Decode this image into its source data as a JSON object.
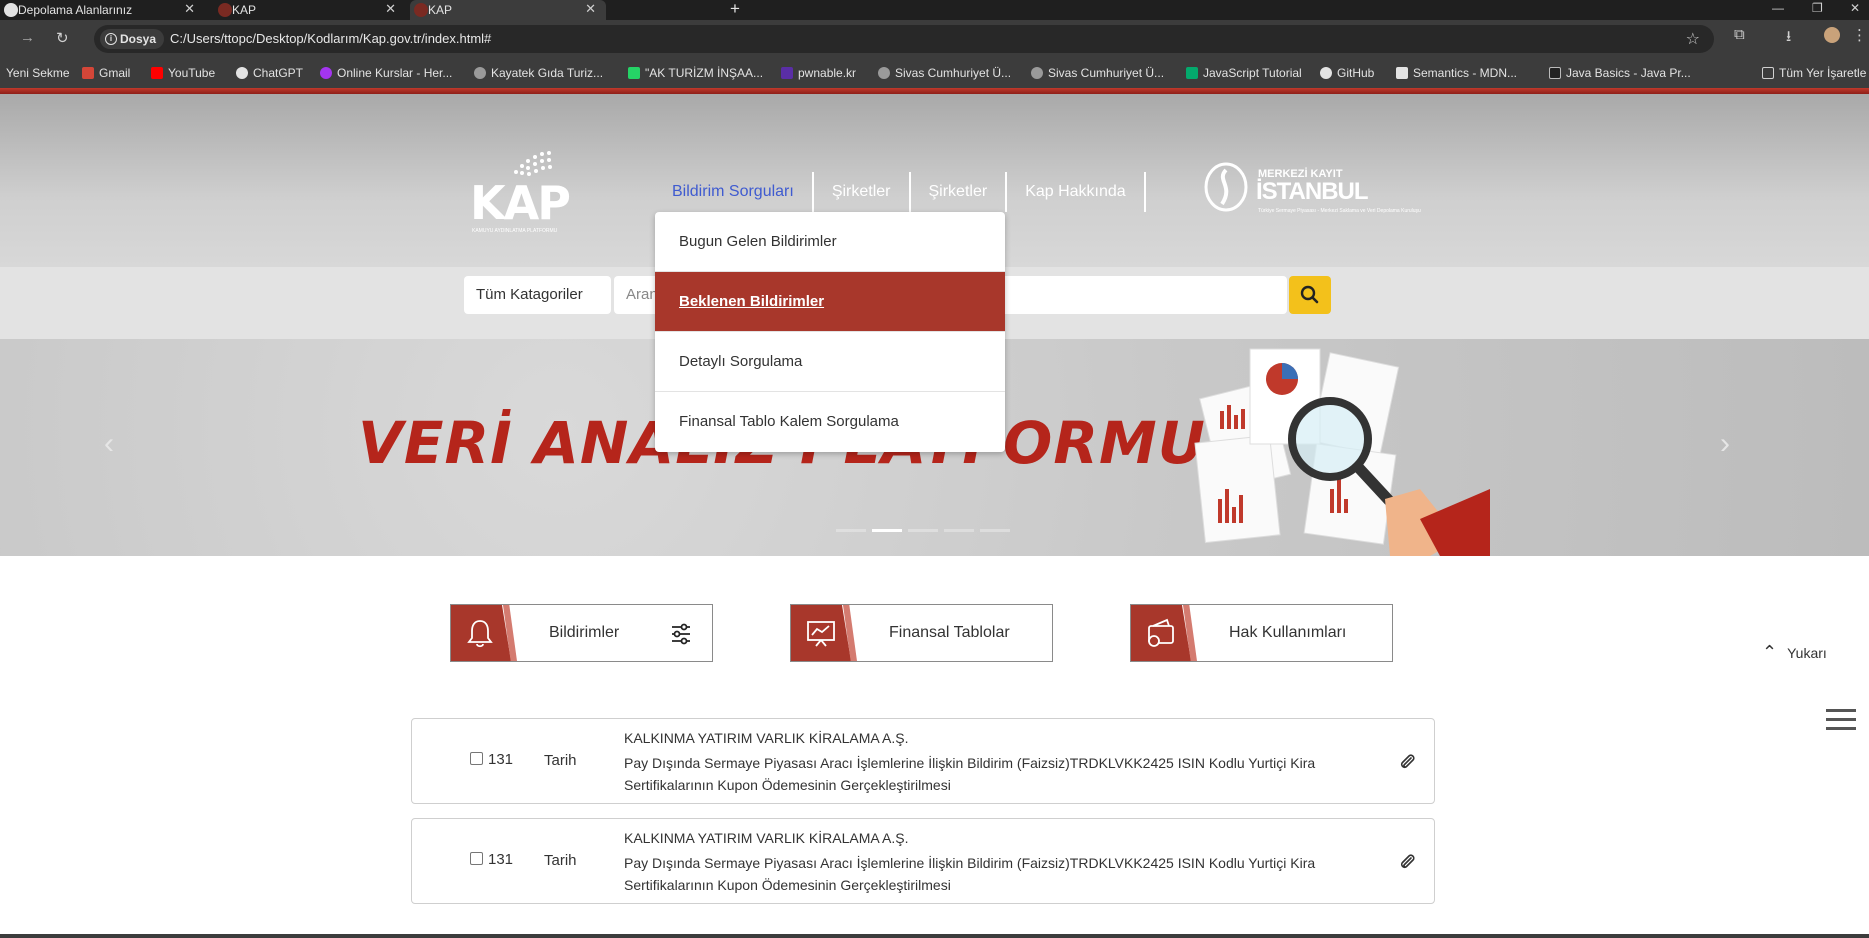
{
  "browser": {
    "tabs": [
      {
        "label": "Depolama Alanlarınız"
      },
      {
        "label": "KAP"
      },
      {
        "label": "KAP"
      }
    ],
    "new_tab": "+",
    "security_label": "Dosya",
    "url": "C:/Users/ttopc/Desktop/Kodlarım/Kap.gov.tr/index.html#",
    "bookmarks": [
      "Yeni Sekme",
      "Gmail",
      "YouTube",
      "ChatGPT",
      "Online Kurslar - Her...",
      "Kayatek Gıda Turiz...",
      "\"AK TURİZM İNŞAA...",
      "pwnable.kr",
      "Sivas Cumhuriyet Ü...",
      "Sivas Cumhuriyet Ü...",
      "JavaScript Tutorial",
      "GitHub",
      "Semantics - MDN...",
      "Java Basics - Java Pr...",
      "Tüm Yer İşaretle"
    ]
  },
  "header": {
    "logo_text": "KAP",
    "logo_sub": "KAMUYU AYDINLATMA PLATFORMU",
    "nav": [
      "Bildirim Sorguları",
      "Şirketler",
      "Şirketler",
      "Kap Hakkında"
    ],
    "partner_logo": {
      "line1": "MERKEZİ KAYIT",
      "line2": "İSTANBUL",
      "line3": "Türkiye Sermaye Piyasası - Merkezi Saklama ve Veri Depolama Kuruluşu"
    }
  },
  "dropdown": {
    "items": [
      "Bugun Gelen Bildirimler",
      "Beklenen Bildirimler",
      "Detaylı Sorgulama",
      "Finansal Tablo Kalem Sorgulama"
    ],
    "active_index": 1
  },
  "search": {
    "category": "Tüm Katagoriler",
    "placeholder": "Aranacak"
  },
  "banner": {
    "title": "VERİ ANALİZ PLATFORMU",
    "active_slide": 2,
    "slide_count": 5
  },
  "quick_links": [
    {
      "label": "Bildirimler",
      "icon": "bell-icon"
    },
    {
      "label": "Finansal Tablolar",
      "icon": "chart-board-icon"
    },
    {
      "label": "Hak Kullanımları",
      "icon": "wallet-icon"
    }
  ],
  "scroll_top": "Yukarı",
  "notifications": [
    {
      "number": "131",
      "date_label": "Tarih",
      "company": "KALKINMA YATIRIM VARLIK KİRALAMA A.Ş.",
      "description": "Pay Dışında Sermaye Piyasası Aracı İşlemlerine İlişkin Bildirim (Faizsiz)TRDKLVKK2425 ISIN Kodlu Yurtiçi Kira Sertifikalarının Kupon Ödemesinin Gerçekleştirilmesi"
    },
    {
      "number": "131",
      "date_label": "Tarih",
      "company": "KALKINMA YATIRIM VARLIK KİRALAMA A.Ş.",
      "description": "Pay Dışında Sermaye Piyasası Aracı İşlemlerine İlişkin Bildirim (Faizsiz)TRDKLVKK2425 ISIN Kodlu Yurtiçi Kira Sertifikalarının Kupon Ödemesinin Gerçekleştirilmesi"
    }
  ],
  "colors": {
    "brand_red": "#a8372b",
    "nav_active": "#3f5bd0",
    "search_button": "#f3c11b"
  }
}
